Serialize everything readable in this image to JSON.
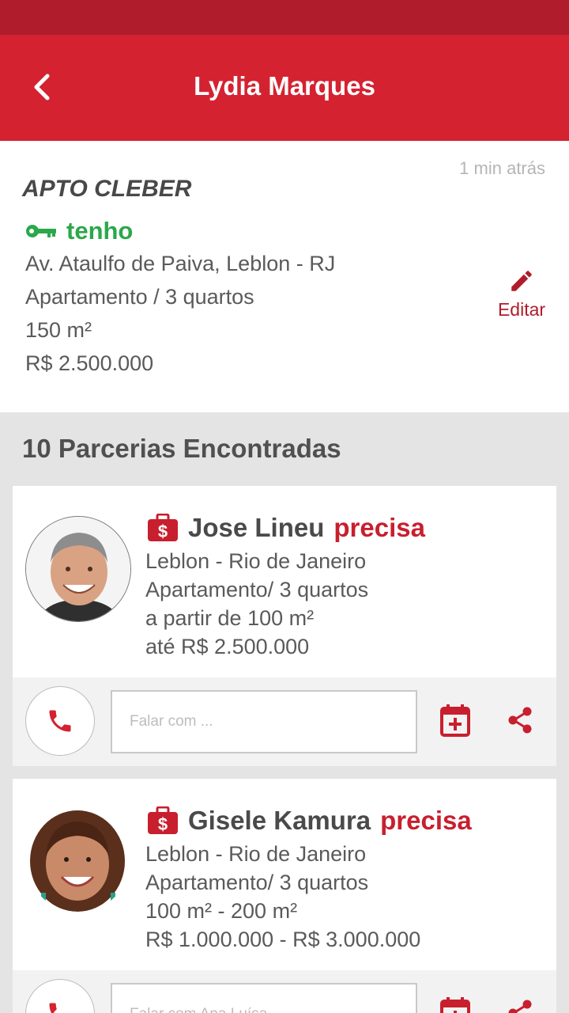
{
  "app_bar": {
    "title": "Lydia Marques"
  },
  "listing": {
    "time_ago": "1 min atrás",
    "name": "APTO CLEBER",
    "status_label": "tenho",
    "address": "Av. Ataulfo de Paiva, Leblon - RJ",
    "type": "Apartamento  / 3 quartos",
    "area": "150 m²",
    "price": "R$ 2.500.000",
    "edit_label": "Editar"
  },
  "results_title": "10 Parcerias Encontradas",
  "partners": [
    {
      "name": "Jose Lineu",
      "need_label": "precisa",
      "location": "Leblon - Rio de Janeiro",
      "type": "Apartamento/ 3 quartos",
      "area": "a partir de 100 m²",
      "price": "até R$ 2.500.000",
      "message_placeholder": "Falar com ..."
    },
    {
      "name": "Gisele Kamura",
      "need_label": "precisa",
      "location": "Leblon - Rio de Janeiro",
      "type": "Apartamento/ 3 quartos",
      "area": "100 m² - 200 m²",
      "price": "R$ 1.000.000 - R$ 3.000.000",
      "message_placeholder": "Falar com Ana Luísa..."
    }
  ],
  "colors": {
    "primary": "#d42231",
    "status_bar": "#b01c2b",
    "have_green": "#2aa84a",
    "need_red": "#c81f2e"
  },
  "icons": {
    "back": "chevron-left-icon",
    "key": "key-icon",
    "edit": "pencil-icon",
    "bag": "money-bag-icon",
    "phone": "phone-icon",
    "calendar": "calendar-add-icon",
    "share": "share-icon"
  }
}
